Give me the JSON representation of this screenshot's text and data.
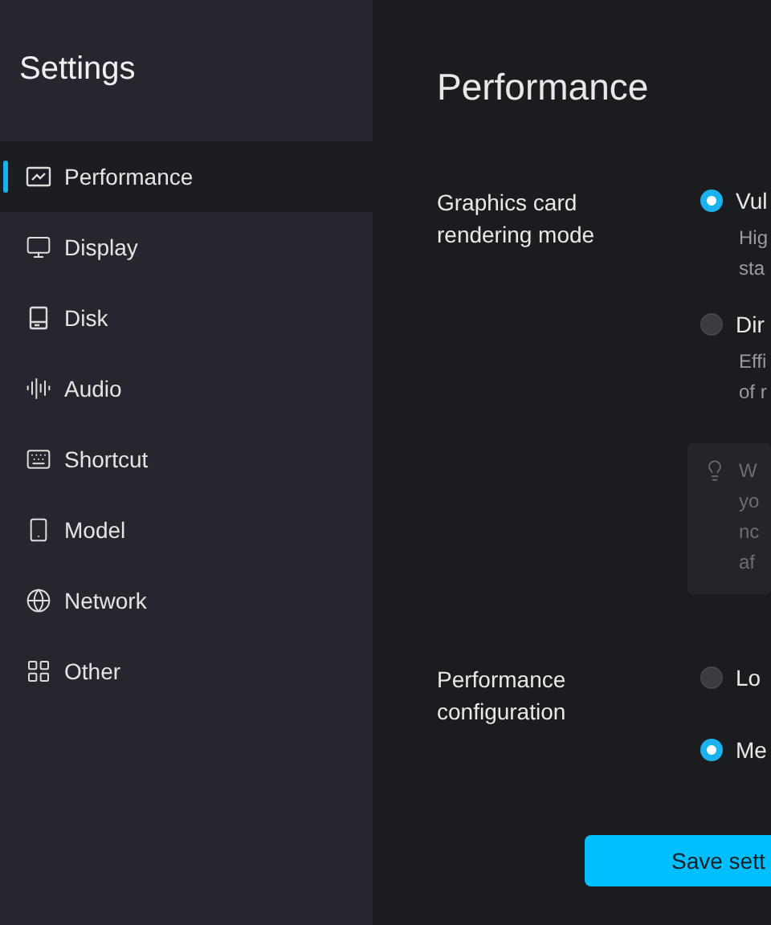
{
  "sidebar": {
    "title": "Settings",
    "items": [
      {
        "label": "Performance",
        "selected": true
      },
      {
        "label": "Display",
        "selected": false
      },
      {
        "label": "Disk",
        "selected": false
      },
      {
        "label": "Audio",
        "selected": false
      },
      {
        "label": "Shortcut",
        "selected": false
      },
      {
        "label": "Model",
        "selected": false
      },
      {
        "label": "Network",
        "selected": false
      },
      {
        "label": "Other",
        "selected": false
      }
    ]
  },
  "main": {
    "title": "Performance",
    "sections": [
      {
        "label": "Graphics card rendering mode",
        "options": [
          {
            "label": "Vul",
            "selected": true,
            "description": [
              "Hig",
              "sta"
            ]
          },
          {
            "label": "Dir",
            "selected": false,
            "description": [
              "Effi",
              "of r"
            ]
          }
        ],
        "tip": [
          "W",
          "yo",
          "nc",
          "af"
        ]
      },
      {
        "label": "Performance configuration",
        "options": [
          {
            "label": "Lo",
            "selected": false
          },
          {
            "label": "Me",
            "selected": true
          }
        ]
      }
    ],
    "save_button": "Save sett"
  }
}
